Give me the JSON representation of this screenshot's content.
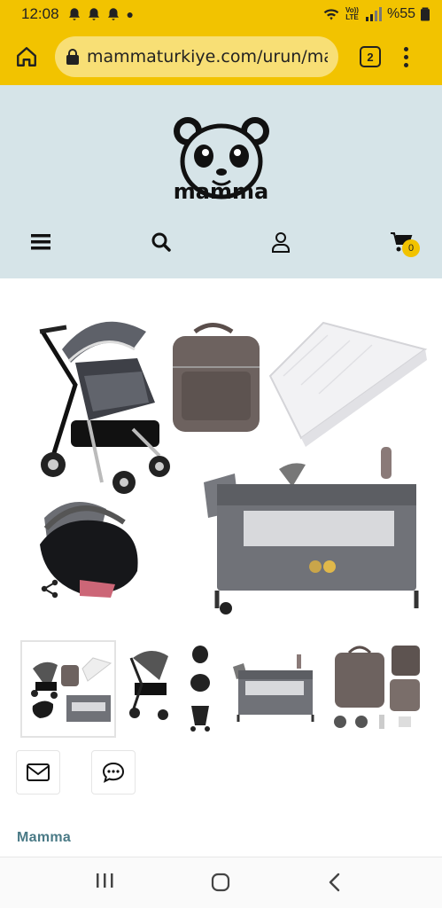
{
  "status_bar": {
    "time": "12:08",
    "battery": "%55",
    "network": "LTE",
    "volte": "Vo))"
  },
  "browser": {
    "url": "mammaturkiye.com/urun/mamma",
    "tab_count": "2",
    "accent_color": "#f2c300"
  },
  "site": {
    "logo_text": "mamma",
    "nav": {
      "icons": [
        "menu-icon",
        "search-icon",
        "user-icon",
        "cart-icon"
      ],
      "cart_count": "0"
    }
  },
  "product": {
    "brand": "Mamma",
    "images": [
      "stroller-set-collage",
      "stroller-variants",
      "playard-crib",
      "diaper-backpack"
    ],
    "actions": [
      "mail-icon",
      "chat-icon"
    ]
  },
  "colors": {
    "header_bg": "#d6e4e8",
    "brand_label": "#4a7a86"
  }
}
